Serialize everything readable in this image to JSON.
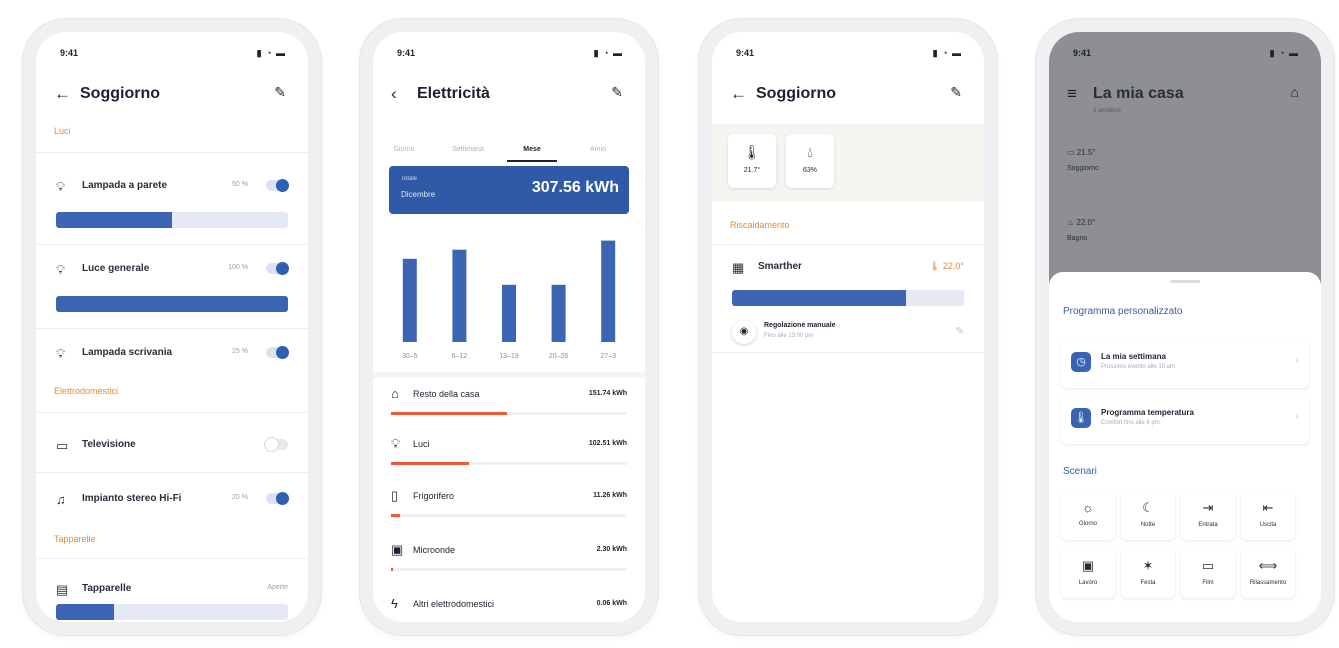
{
  "status": {
    "time": "9:41",
    "signal": "▮ ◔ ▬"
  },
  "p1": {
    "title": "Soggiorno",
    "section_luci": "Luci",
    "lights": [
      {
        "label": "Lampada a parete",
        "level": "50 %",
        "brightness": 0.5,
        "on": true
      },
      {
        "label": "Luce generale",
        "level": "100 %",
        "brightness": 1.0,
        "on": true
      },
      {
        "label": "Lampada scrivania",
        "level": "25 %",
        "on": true
      }
    ],
    "section_elettro": "Elettrodomestici",
    "appliances": [
      {
        "label": "Televisione",
        "on": false
      },
      {
        "label": "Impianto stereo Hi-Fi",
        "level": "20 %",
        "on": true
      }
    ],
    "section_tapparelle": "Tapparelle",
    "blind": {
      "label": "Tapparelle",
      "status": "Aperte",
      "open": 0.25
    }
  },
  "p2": {
    "title": "Elettricità",
    "tabs": [
      "Giorno",
      "Settimana",
      "Mese",
      "Anno"
    ],
    "banner_label": "Totale",
    "banner_period": "Dicembre",
    "banner_value": "307.56 kWh",
    "chart_data": {
      "type": "bar",
      "categories": [
        "30–5",
        "6–12",
        "13–19",
        "20–26",
        "27–3"
      ],
      "values": [
        64,
        71,
        44,
        44,
        78
      ],
      "ylim": [
        0,
        80
      ],
      "color": "#3c66b3",
      "grid": false
    },
    "consumption": [
      {
        "label": "Resto della casa",
        "value": "151.74 kWh",
        "share": 0.49
      },
      {
        "label": "Luci",
        "value": "102.51 kWh",
        "share": 0.33
      },
      {
        "label": "Frigorifero",
        "value": "11.26 kWh",
        "share": 0.04
      },
      {
        "label": "Microonde",
        "value": "2.30 kWh",
        "share": 0.01
      },
      {
        "label": "Altri elettrodomestici",
        "value": "0.06 kWh",
        "share": 0.0
      }
    ]
  },
  "p3": {
    "title": "Soggiorno",
    "tiles": [
      {
        "icon": "thermometer-icon",
        "value": "21.7°"
      },
      {
        "icon": "humidity-icon",
        "value": "63%"
      }
    ],
    "section": "Riscaldamento",
    "device": {
      "label": "Smarther",
      "setpoint": "22.0°",
      "level": 0.75
    },
    "mode": {
      "label": "Regolazione manuale",
      "sub": "Fino alle 13:00 pm"
    }
  },
  "p4": {
    "title": "La mia casa",
    "subtitle": "3 ambienti",
    "rooms": [
      {
        "name": "Soggiorno",
        "temp": "21.5°"
      },
      {
        "name": "Bagno",
        "temp": "22.0°"
      }
    ],
    "sheet_title": "Programma personalizzato",
    "programs": [
      {
        "title": "La mia settimana",
        "sub": "Prossimo evento alle 10 am"
      },
      {
        "title": "Programma temperatura",
        "sub": "Comfort fino alle 6 pm"
      }
    ],
    "scenes_title": "Scenari",
    "scenes": [
      {
        "label": "Giorno",
        "icon": "sun-icon"
      },
      {
        "label": "Notte",
        "icon": "moon-icon"
      },
      {
        "label": "Entrata",
        "icon": "enter-icon"
      },
      {
        "label": "Uscita",
        "icon": "exit-icon"
      },
      {
        "label": "Lavoro",
        "icon": "briefcase-icon"
      },
      {
        "label": "Festa",
        "icon": "party-icon"
      },
      {
        "label": "Film",
        "icon": "tv-icon"
      },
      {
        "label": "Rilassamento",
        "icon": "relax-icon"
      }
    ]
  }
}
